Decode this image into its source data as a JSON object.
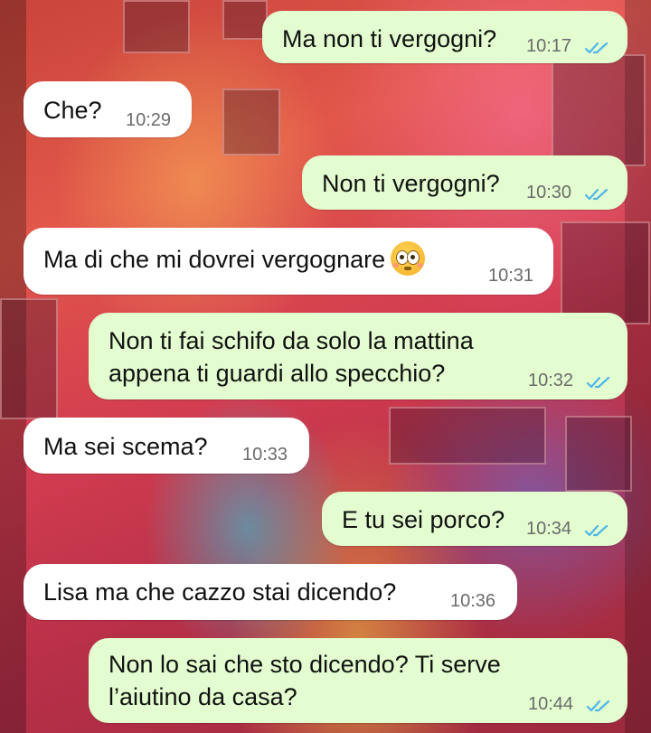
{
  "messages": [
    {
      "direction": "out",
      "text_lines": [
        "Ma non ti vergogni?"
      ],
      "time": "10:17",
      "status": "read"
    },
    {
      "direction": "in",
      "text_lines": [
        "Che?"
      ],
      "time": "10:29"
    },
    {
      "direction": "out",
      "text_lines": [
        "Non ti vergogni?"
      ],
      "time": "10:30",
      "status": "read"
    },
    {
      "direction": "in",
      "text_lines": [
        "Ma di che mi dovrei vergognare"
      ],
      "emoji": "flushed-face",
      "time": "10:31"
    },
    {
      "direction": "out",
      "text_lines": [
        "Non ti fai schifo da solo la mattina",
        "appena ti guardi allo specchio?"
      ],
      "time": "10:32",
      "status": "read"
    },
    {
      "direction": "in",
      "text_lines": [
        "Ma sei scema?"
      ],
      "time": "10:33"
    },
    {
      "direction": "out",
      "text_lines": [
        "E tu sei porco?"
      ],
      "time": "10:34",
      "status": "read"
    },
    {
      "direction": "in",
      "text_lines": [
        "Lisa ma che cazzo stai dicendo?"
      ],
      "time": "10:36"
    },
    {
      "direction": "out",
      "text_lines": [
        "Non lo sai che sto dicendo? Ti serve",
        "l’aiutino da casa?"
      ],
      "time": "10:44",
      "status": "read"
    }
  ],
  "colors": {
    "outgoing_bubble": "#e3fdd0",
    "incoming_bubble": "#ffffff",
    "read_ticks": "#4fb6ec",
    "timestamp": "#6b6b6b"
  }
}
